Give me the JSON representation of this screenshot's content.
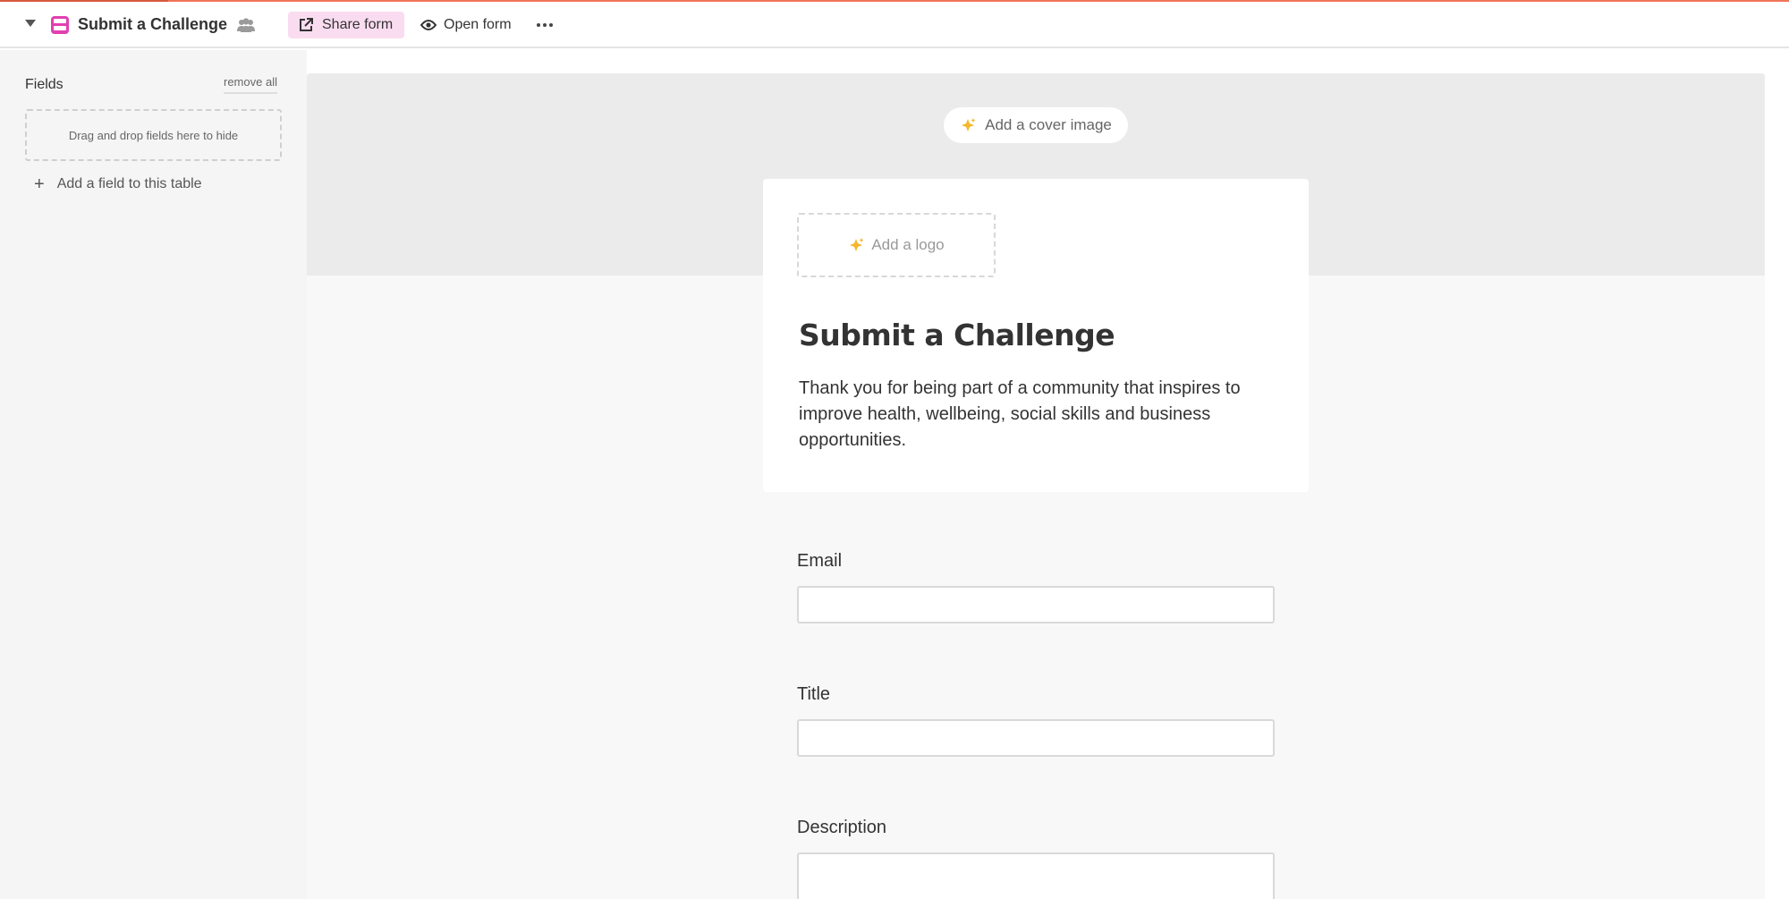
{
  "toolbar": {
    "view_title": "Submit a Challenge",
    "share_label": "Share form",
    "open_label": "Open form"
  },
  "sidebar": {
    "fields_label": "Fields",
    "remove_all_label": "remove all",
    "dropzone_text": "Drag and drop fields here to hide",
    "add_field_label": "Add a field to this table"
  },
  "form": {
    "cover_label": "Add a cover image",
    "logo_label": "Add a logo",
    "title": "Submit a Challenge",
    "description": "Thank you for being part of a community that inspires to improve health, wellbeing, social skills and business opportunities.",
    "fields": [
      {
        "label": "Email",
        "value": ""
      },
      {
        "label": "Title",
        "value": ""
      },
      {
        "label": "Description",
        "value": ""
      }
    ]
  },
  "colors": {
    "accent": "#f0745a",
    "view_icon": "#e23fb0",
    "share_bg": "#fadcf0",
    "sparkle": "#f5b82e"
  },
  "icons": {
    "view": "form-view-icon",
    "collaborators": "people-icon",
    "share": "external-link-icon",
    "open": "eye-icon",
    "more": "ellipsis-icon",
    "add": "plus-icon",
    "sparkle": "sparkle-icon"
  }
}
